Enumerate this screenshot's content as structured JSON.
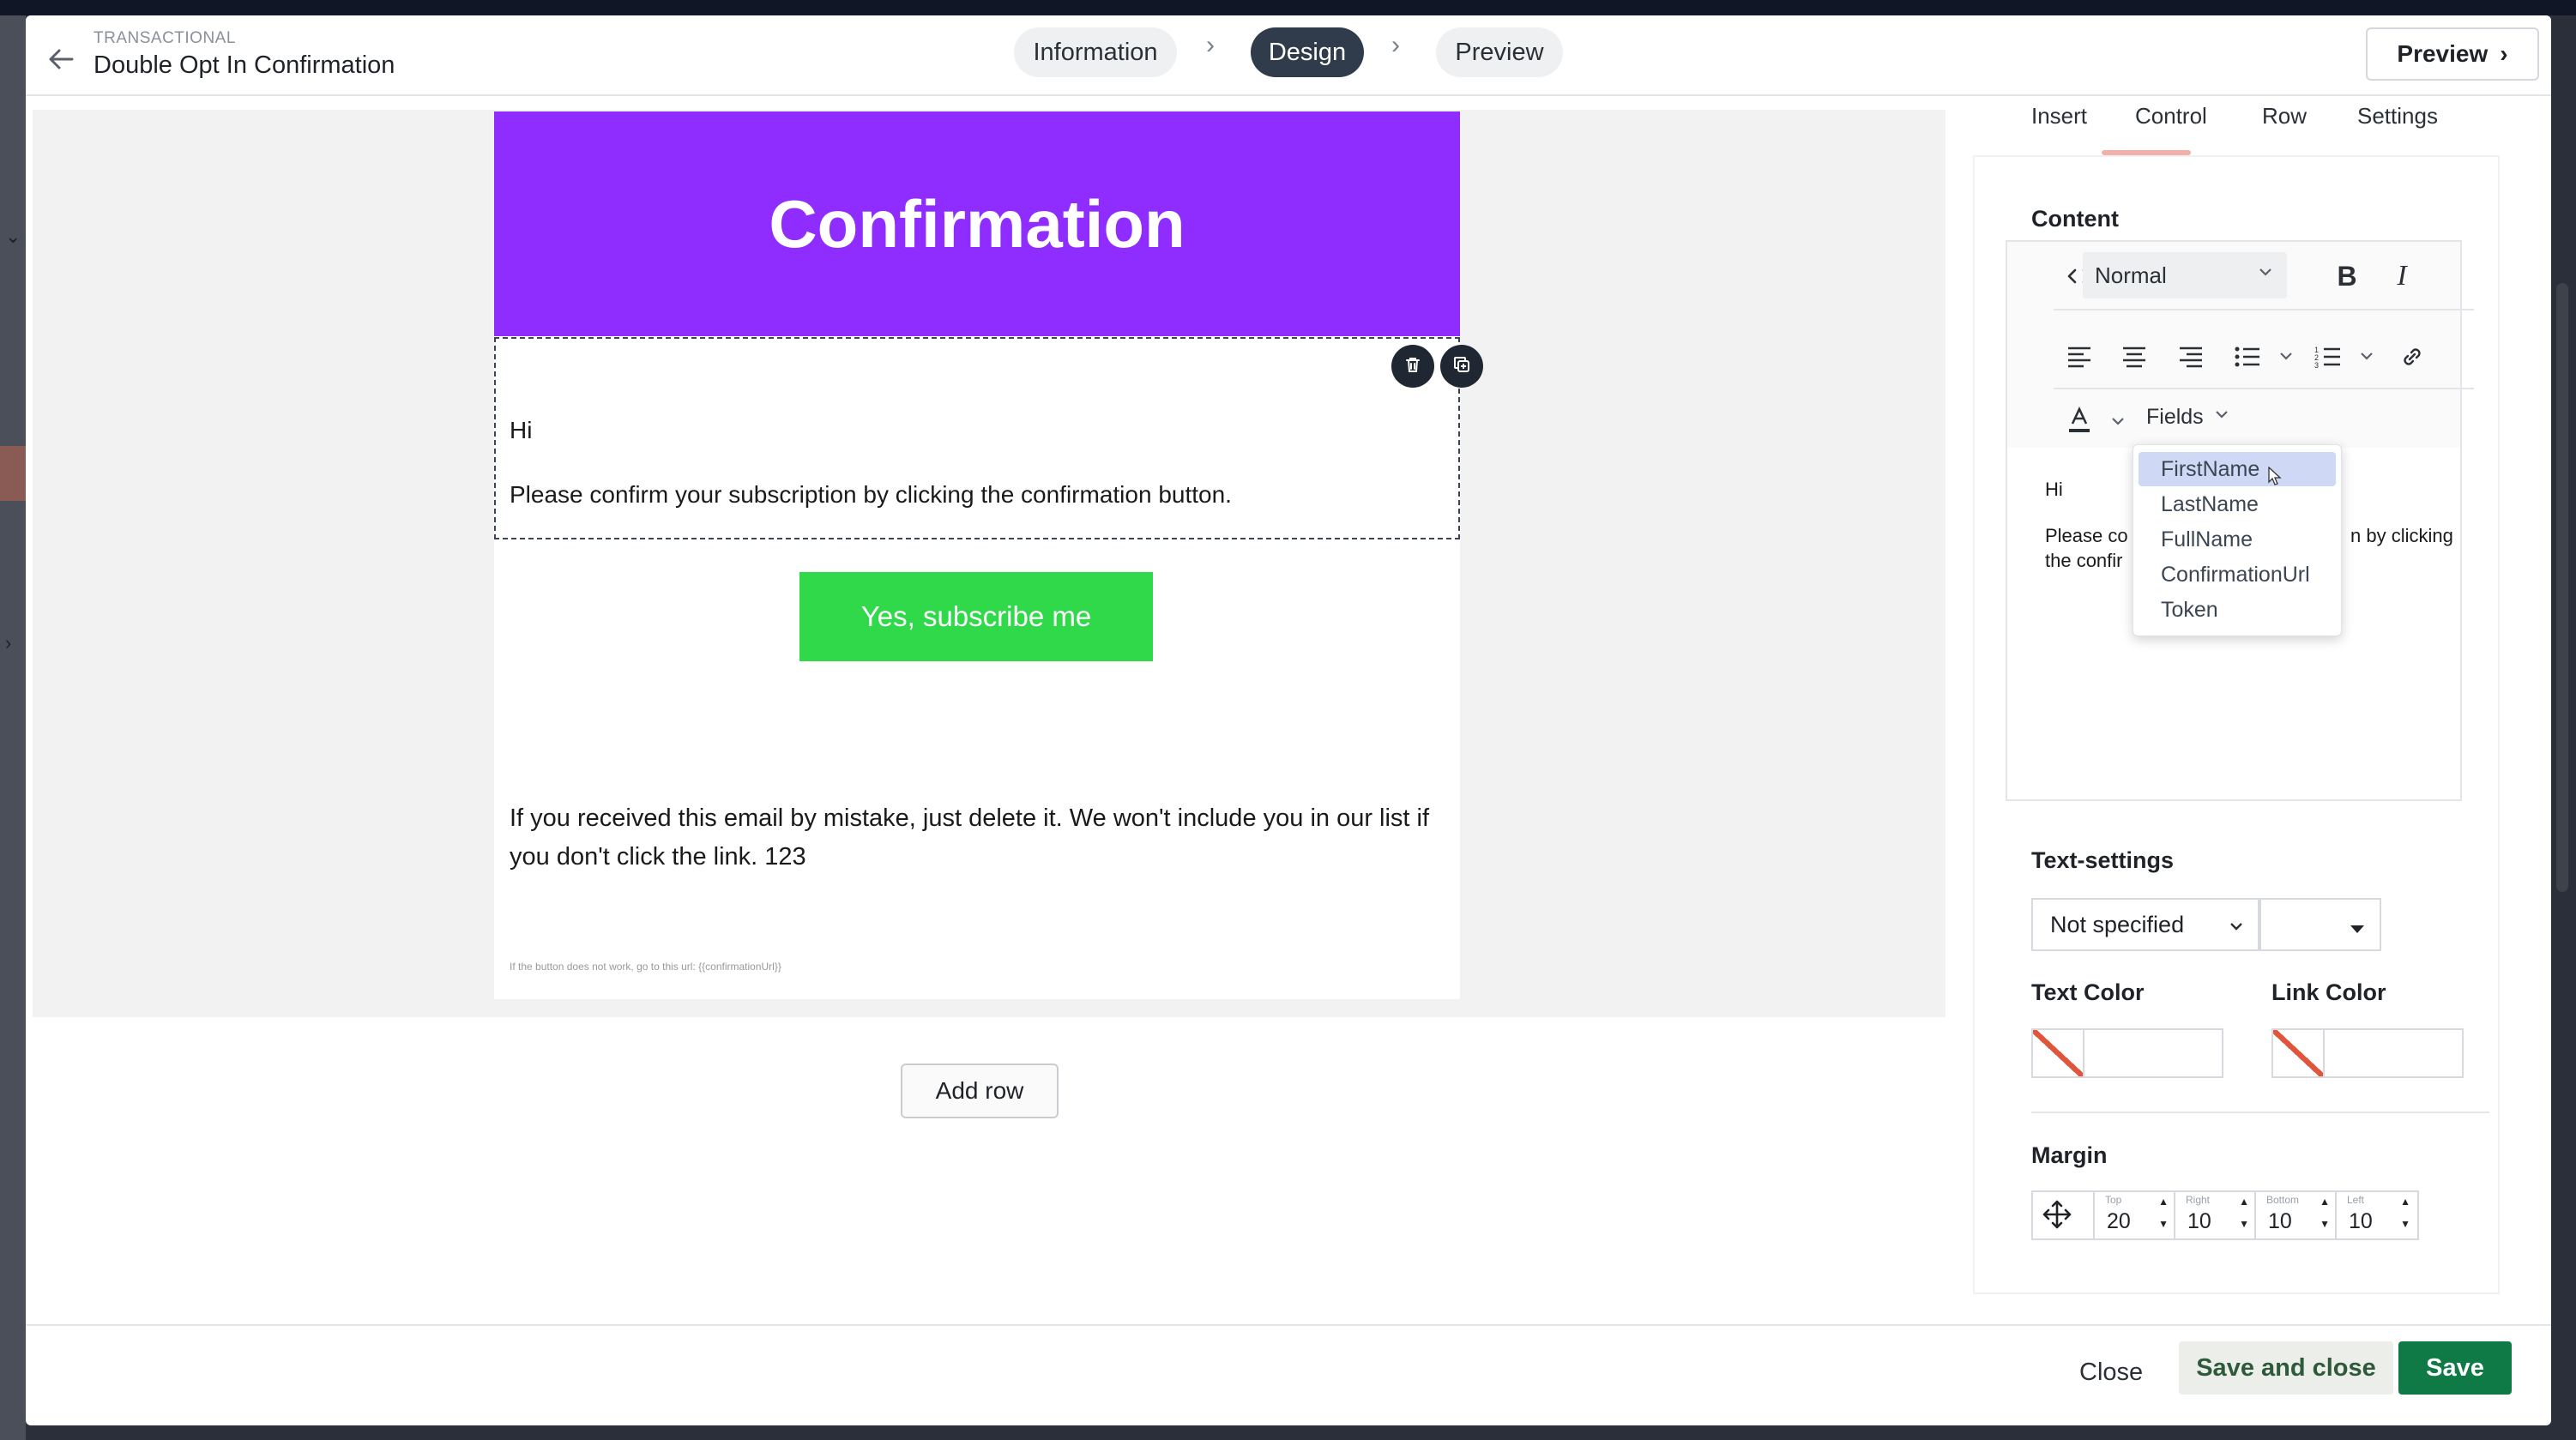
{
  "header": {
    "kicker": "TRANSACTIONAL",
    "title": "Double Opt In Confirmation",
    "steps": [
      {
        "label": "Information",
        "active": false
      },
      {
        "label": "Design",
        "active": true
      },
      {
        "label": "Preview",
        "active": false
      }
    ],
    "preview_button": "Preview"
  },
  "email": {
    "banner_title": "Confirmation",
    "greeting": "Hi",
    "body": "Please confirm your subscription by clicking the confirmation button.",
    "cta_label": "Yes, subscribe me",
    "mistake_text": "If you received this email by mistake, just delete it. We won't include you in our list if you don't click the link. 123",
    "fallback_text": "If the button does not work, go to this url: {{confirmationUrl}}",
    "banner_color": "#8f2cff",
    "cta_color": "#2fd94a"
  },
  "canvas": {
    "add_row": "Add row"
  },
  "panel": {
    "tabs": [
      {
        "label": "Insert",
        "active": false
      },
      {
        "label": "Control",
        "active": true
      },
      {
        "label": "Row",
        "active": false
      },
      {
        "label": "Settings",
        "active": false
      }
    ],
    "content_title": "Content",
    "format_value": "Normal",
    "fields_label": "Fields",
    "fields_options": [
      "FirstName",
      "LastName",
      "FullName",
      "ConfirmationUrl",
      "Token"
    ],
    "fields_selected": "FirstName",
    "editor_line1": "Hi",
    "editor_line2_start": "Please co",
    "editor_line2_end": "n by clicking",
    "editor_line3": "the confir",
    "text_settings_title": "Text-settings",
    "text_settings_value": "Not specified",
    "text_color_label": "Text Color",
    "link_color_label": "Link Color",
    "margin_title": "Margin",
    "margin": [
      {
        "label": "Top",
        "value": "20"
      },
      {
        "label": "Right",
        "value": "10"
      },
      {
        "label": "Bottom",
        "value": "10"
      },
      {
        "label": "Left",
        "value": "10"
      }
    ]
  },
  "footer": {
    "close": "Close",
    "save_and_close": "Save and close",
    "save": "Save"
  },
  "icons": [
    "back-arrow-icon",
    "chevron-right-icon",
    "trash-icon",
    "duplicate-icon",
    "code-icon",
    "bold-icon",
    "italic-icon",
    "align-left-icon",
    "align-center-icon",
    "align-right-icon",
    "bullet-list-icon",
    "numbered-list-icon",
    "link-icon",
    "text-color-icon",
    "chevron-down-icon",
    "move-icon"
  ],
  "colors": {
    "primary_save": "#0f7a45",
    "step_active": "#303c4c",
    "accent_tab": "#f3b0a8"
  }
}
